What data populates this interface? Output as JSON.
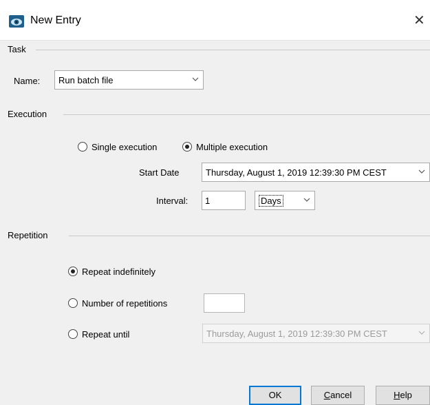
{
  "window": {
    "title": "New Entry",
    "close_glyph": "✕",
    "icon": "app-eye-icon"
  },
  "task": {
    "section_label": "Task",
    "name_label": "Name:",
    "name_value": "Run batch file"
  },
  "execution": {
    "section_label": "Execution",
    "single_label": "Single execution",
    "multiple_label": "Multiple execution",
    "selected": "multiple",
    "start_date_label": "Start Date",
    "start_date_value": "Thursday, August 1, 2019 12:39:30 PM CEST",
    "interval_label": "Interval:",
    "interval_value": "1",
    "interval_unit": "Days"
  },
  "repetition": {
    "section_label": "Repetition",
    "indefinitely_label": "Repeat indefinitely",
    "number_label": "Number of repetitions",
    "until_label": "Repeat until",
    "number_value": "",
    "until_value": "Thursday, August 1, 2019 12:39:30 PM CEST",
    "selected": "indefinitely"
  },
  "buttons": {
    "ok": "OK",
    "cancel_mnemonic": "C",
    "cancel_rest": "ancel",
    "help_mnemonic": "H",
    "help_rest": "elp"
  },
  "colors": {
    "accent": "#0078d7",
    "background": "#f0f0f0"
  }
}
